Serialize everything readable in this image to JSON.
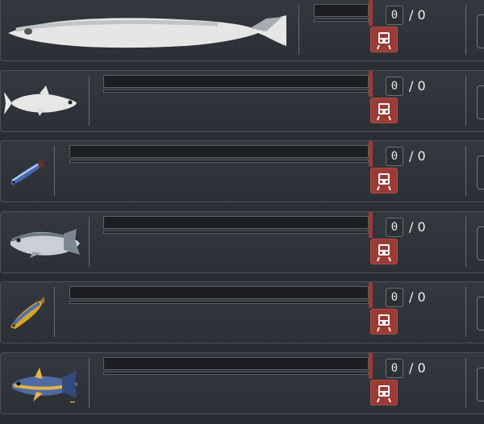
{
  "rows": [
    {
      "fish": "long-silver-fish-icon",
      "count": "0",
      "total": "/ 0"
    },
    {
      "fish": "white-fish-icon",
      "count": "0",
      "total": "/ 0"
    },
    {
      "fish": "small-blue-fish-icon",
      "count": "0",
      "total": "/ 0"
    },
    {
      "fish": "sea-bass-icon",
      "count": "0",
      "total": "/ 0"
    },
    {
      "fish": "mackerel-icon",
      "count": "0",
      "total": "/ 0"
    },
    {
      "fish": "tuna-icon",
      "count": "0",
      "total": "/ 0"
    }
  ],
  "icons": {
    "train": "train-icon"
  }
}
